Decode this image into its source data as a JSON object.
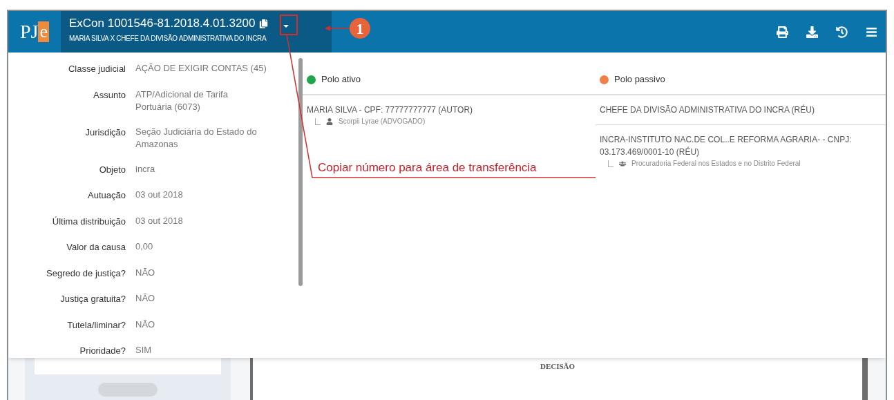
{
  "header": {
    "logo": {
      "p": "PJ",
      "e": "e"
    },
    "process_number": "ExCon 1001546-81.2018.4.01.3200",
    "parties": "MARIA SILVA X CHEFE DA DIVISÃO ADMINISTRATIVA DO INCRA"
  },
  "details": [
    {
      "label": "Classe judicial",
      "value": "AÇÃO DE EXIGIR CONTAS (45)"
    },
    {
      "label": "Assunto",
      "value": "ATP/Adicional de Tarifa Portuária (6073)"
    },
    {
      "label": "Jurisdição",
      "value": "Seção Judiciária do Estado do Amazonas"
    },
    {
      "label": "Objeto",
      "value": "incra"
    },
    {
      "label": "Autuação",
      "value": "03 out 2018"
    },
    {
      "label": "Última distribuição",
      "value": "03 out 2018"
    },
    {
      "label": "Valor da causa",
      "value": "0,00"
    },
    {
      "label": "Segredo de justiça?",
      "value": "NÃO"
    },
    {
      "label": "Justiça gratuita?",
      "value": "NÃO"
    },
    {
      "label": "Tutela/liminar?",
      "value": "NÃO"
    },
    {
      "label": "Prioridade?",
      "value": "SIM"
    }
  ],
  "poles": [
    {
      "title": "Polo ativo",
      "color": "#1fa64a",
      "parties": [
        {
          "name": "MARIA SILVA - CPF: 77777777777 (AUTOR)",
          "representatives": [
            {
              "kind": "person",
              "name": "Scorpii Lyrae (ADVOGADO)"
            }
          ]
        }
      ]
    },
    {
      "title": "Polo passivo",
      "color": "#f0804a",
      "parties": [
        {
          "name": "CHEFE DA DIVISÃO ADMINISTRATIVA DO INCRA (RÉU)"
        },
        {
          "name": "INCRA-INSTITUTO NAC.DE COL..E REFORMA AGRARIA- - CNPJ: 03.173.469/0001-10 (RÉU)",
          "representatives": [
            {
              "kind": "group",
              "name": "Procuradoria Federal nos Estados e no Distrito Federal"
            }
          ]
        }
      ]
    }
  ],
  "background": {
    "document_heading": "DECISÃO"
  },
  "annotations": {
    "step": "1",
    "callout": "Copiar número para área de transferência"
  }
}
